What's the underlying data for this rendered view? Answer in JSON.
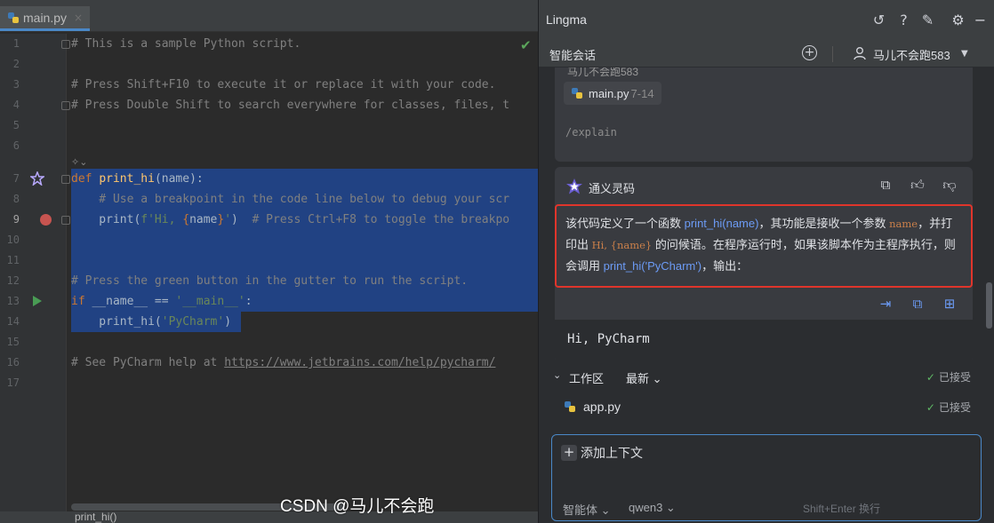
{
  "editor": {
    "tab_label": "main.py",
    "close_glyph": "×",
    "line_numbers": [
      "1",
      "2",
      "3",
      "4",
      "5",
      "6",
      "7",
      "8",
      "9",
      "10",
      "11",
      "12",
      "13",
      "14",
      "15",
      "16",
      "17"
    ],
    "lines": {
      "l1": "# This is a sample Python script.",
      "l3": "# Press Shift+F10 to execute it or replace it with your code.",
      "l4": "# Press Double Shift to search everywhere for classes, files, t",
      "l7_kw": "def ",
      "l7_fn": "print_hi",
      "l7_rest": "(name):",
      "l8": "    # Use a breakpoint in the code line below to debug your scr",
      "l9_a": "    print(",
      "l9_b": "f'Hi, ",
      "l9_c": "{",
      "l9_d": "name",
      "l9_e": "}",
      "l9_f": "'",
      "l9_g": ")",
      "l9_h": "  # Press Ctrl+F8 to toggle the breakpo",
      "l12": "# Press the green button in the gutter to run the script.",
      "l13_kw": "if ",
      "l13_mid": "__name__ == ",
      "l13_str": "'__main__'",
      "l13_end": ":",
      "l14_a": "    print_hi(",
      "l14_b": "'PyCharm'",
      "l14_c": ")",
      "l16_a": "# See PyCharm help at ",
      "l16_link": "https://www.jetbrains.com/help/pycharm/"
    },
    "breadcrumb": "print_hi()",
    "colors": {
      "background": "#2b2b2b",
      "selection": "#214283",
      "keyword": "#cc7832",
      "function": "#ffc66d",
      "string": "#6a8759",
      "comment": "#808080",
      "breakpoint": "#c75450",
      "run": "#499c54"
    }
  },
  "panel": {
    "title": "Lingma",
    "header_icons": [
      "history-icon",
      "help-icon",
      "edit-icon",
      "settings-icon",
      "minimize-icon"
    ],
    "sub_tab": "智能会话",
    "user_name": "马儿不会跑583",
    "request": {
      "ref_file": "main.py",
      "ref_lines": "7-14",
      "command": "/explain"
    },
    "answer": {
      "author": "通义灵码",
      "text_1": "该代码定义了一个函数 ",
      "ref_1": "print_hi(name)",
      "text_2": "，其功能是接收一个参数 ",
      "ref_2": "name",
      "text_3": "，并打印出 ",
      "ref_3": "Hi, {name}",
      "text_4": " 的问候语。在程序运行时，如果该脚本作为主程序执行，则会调用 ",
      "ref_4": "print_hi('PyCharm')",
      "text_5": "，输出：",
      "code_output": "Hi, PyCharm"
    },
    "workspace": {
      "title": "工作区",
      "filter": "最新",
      "status_1": "已接受",
      "file": "app.py",
      "status_2": "已接受"
    },
    "input": {
      "add_context": "添加上下文",
      "mode": "智能体",
      "model": "qwen3",
      "shortcut_hint": "Shift+Enter 换行"
    },
    "watermark": "CSDN @马儿不会跑",
    "colors": {
      "accent_blue": "#4a88c7",
      "highlight_border": "#e0352b",
      "reference": "#6c9bf5",
      "accepted": "#5fb865"
    }
  }
}
